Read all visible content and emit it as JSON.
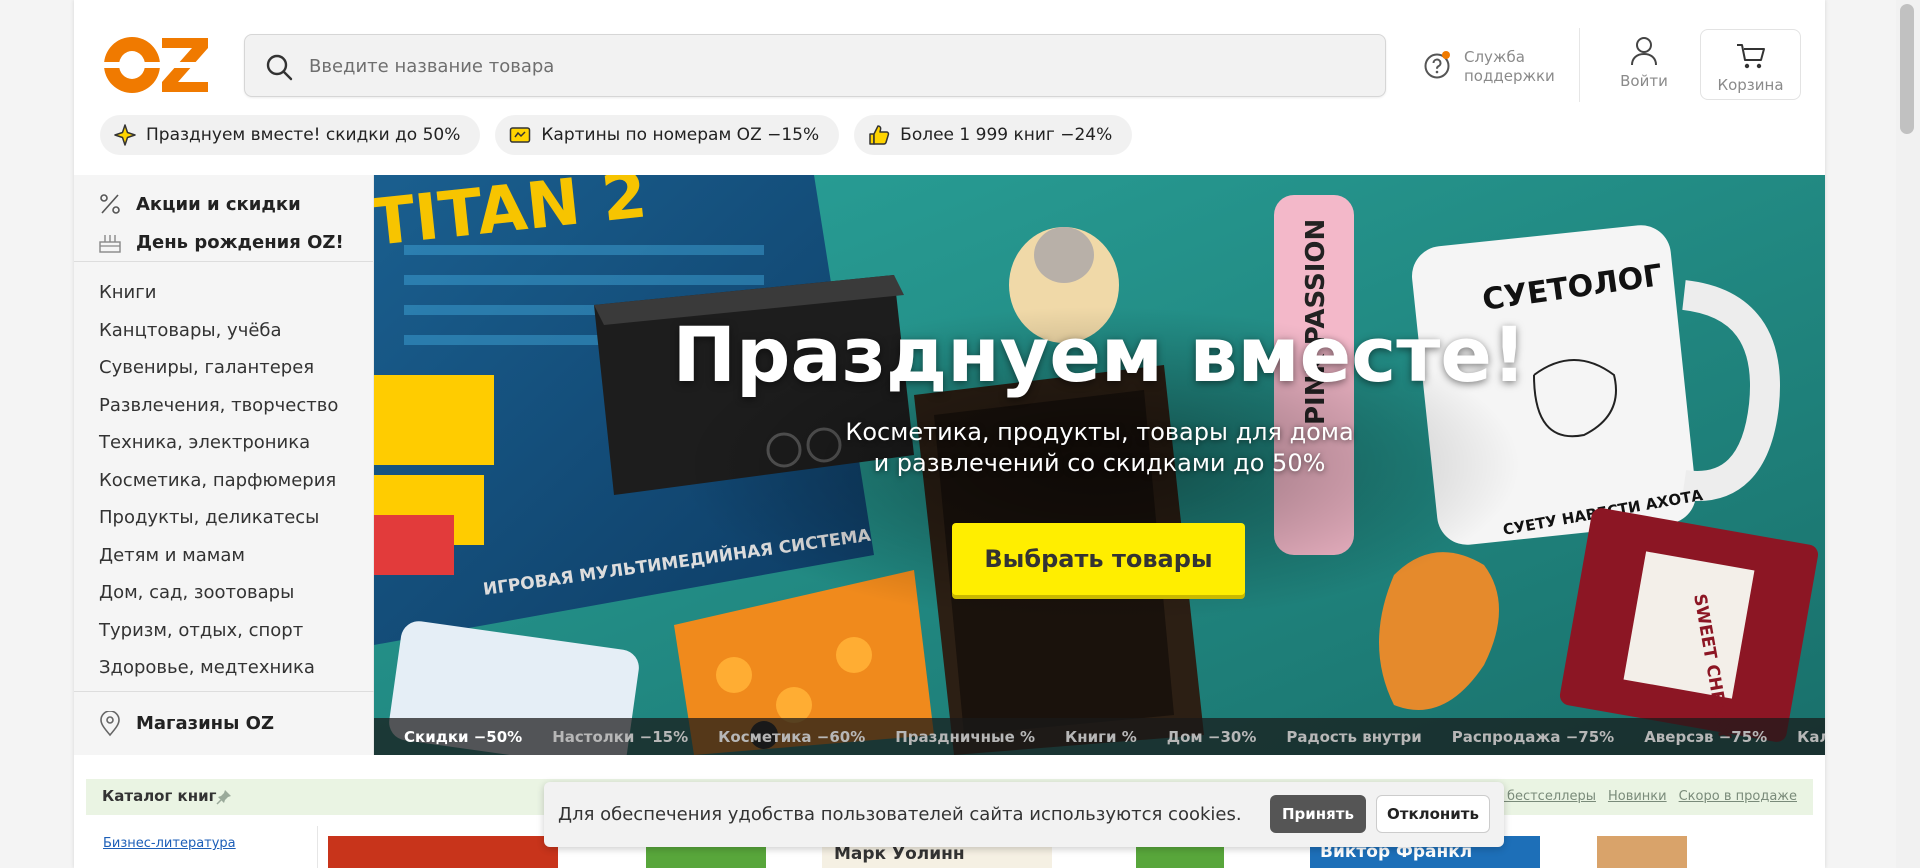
{
  "header": {
    "logo_text": "OZ",
    "search": {
      "placeholder": "Введите название товара"
    },
    "support_label": "Служба поддержки",
    "login_label": "Войти",
    "cart_label": "Корзина"
  },
  "promos": [
    {
      "icon": "sparkle-icon",
      "label": "Празднуем вместе! скидки до 50%"
    },
    {
      "icon": "ticket-icon",
      "label": "Картины по номерам OZ −15%"
    },
    {
      "icon": "thumbs-up-icon",
      "label": "Более 1 999 книг −24%"
    }
  ],
  "sidebar": {
    "top_items": [
      {
        "icon": "percent-icon",
        "label": "Акции и скидки"
      },
      {
        "icon": "cake-icon",
        "label": "День рождения OZ!"
      }
    ],
    "categories": [
      "Книги",
      "Канцтовары, учёба",
      "Сувениры, галантерея",
      "Развлечения, творчество",
      "Техника, электроника",
      "Косметика, парфюмерия",
      "Продукты, деликатесы",
      "Детям и мамам",
      "Дом, сад, зоотовары",
      "Туризм, отдых, спорт",
      "Здоровье, медтехника"
    ],
    "stores_label": "Магазины OZ"
  },
  "banner": {
    "title": "Празднуем вместе!",
    "subtitle_line1": "Косметика, продукты, товары для дома",
    "subtitle_line2": "и развлечений со скидками до 50%",
    "cta_label": "Выбрать товары",
    "artwork_texts": {
      "mug_top": "СУЕТОЛОГ",
      "mug_bottom": "СУЕТУ НАВЕСТИ АХОТА",
      "console": "ИГРОВАЯ МУЛЬТИМЕДИЙНАЯ СИСТЕМА",
      "bottle": "SWEET CHERRY",
      "spray": "PINK PASSION",
      "box": "TITAN 2"
    },
    "tabs": [
      {
        "label": "Скидки −50%",
        "active": true
      },
      {
        "label": "Настолки −15%",
        "active": false
      },
      {
        "label": "Косметика −60%",
        "active": false
      },
      {
        "label": "Праздничные %",
        "active": false
      },
      {
        "label": "Книги %",
        "active": false
      },
      {
        "label": "Дом −30%",
        "active": false
      },
      {
        "label": "Радость внутри",
        "active": false
      },
      {
        "label": "Распродажа −75%",
        "active": false
      },
      {
        "label": "Аверсэв −75%",
        "active": false
      },
      {
        "label": "Календар",
        "active": false
      }
    ]
  },
  "catalog": {
    "title": "Каталог книг",
    "links": [
      "Все бестселлеры",
      "Новинки",
      "Скоро в продаже"
    ],
    "first_category": "Бизнес-литература",
    "book_titles": [
      "Марк Уолинн",
      "Виктор Франкл"
    ]
  },
  "cookie": {
    "text": "Для обеспечения удобства пользователей сайта используются cookies.",
    "accept_label": "Принять",
    "decline_label": "Отклонить"
  },
  "colors": {
    "brand_orange": "#f07a00",
    "cta_yellow": "#ffee00",
    "catalog_bg": "#eaf4e3",
    "link_blue": "#1d5fb8"
  }
}
